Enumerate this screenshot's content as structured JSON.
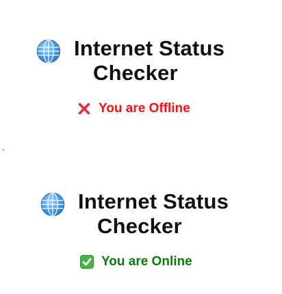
{
  "panels": [
    {
      "title_line1": "Internet Status",
      "title_line2": "Checker",
      "title_icon": "globe-icon",
      "status_icon": "cross-icon",
      "status_text": "You are Offline",
      "status_color": "#ff1010"
    },
    {
      "title_line1": "Internet Status",
      "title_line2": "Checker",
      "title_icon": "globe-icon",
      "status_icon": "check-icon",
      "status_text": "You are Online",
      "status_color": "#0b7a0b"
    }
  ],
  "colors": {
    "background": "#ffffff",
    "title": "#111111",
    "globe": "#3d8fe0",
    "offline_cross": "#e0323a",
    "online_check_bg": "#46b34a"
  }
}
